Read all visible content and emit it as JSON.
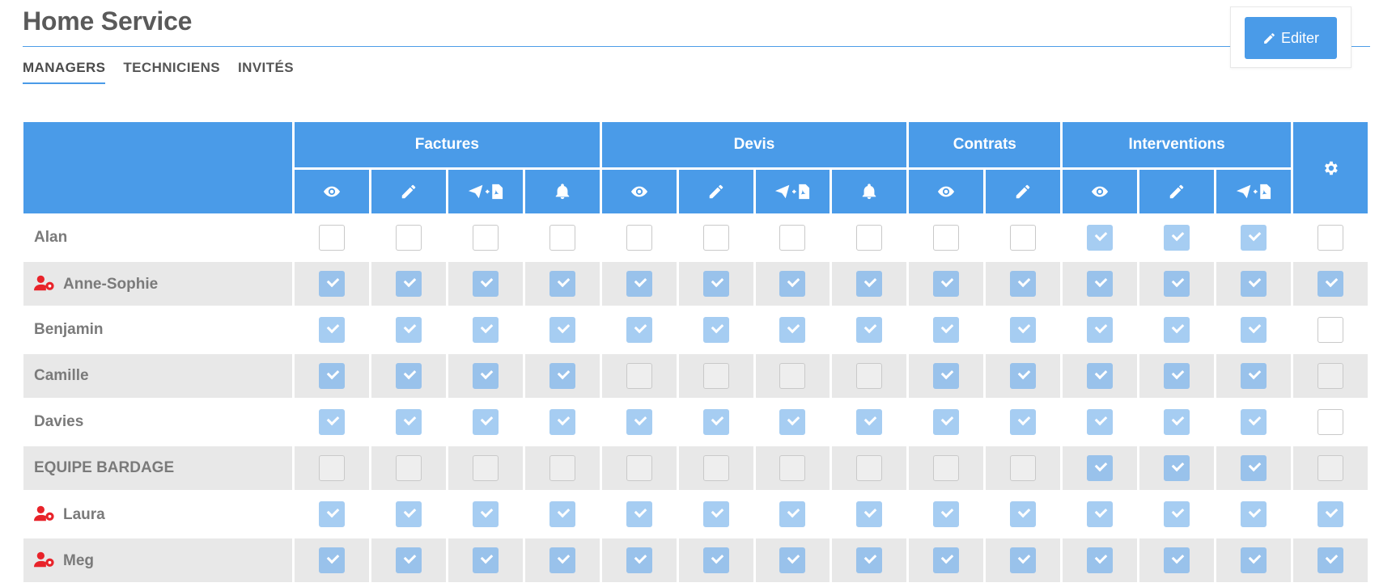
{
  "header": {
    "title": "Home Service",
    "edit_label": "Editer"
  },
  "tabs": [
    {
      "label": "MANAGERS",
      "active": true
    },
    {
      "label": "TECHNICIENS",
      "active": false
    },
    {
      "label": "INVITÉS",
      "active": false
    }
  ],
  "groups": [
    {
      "label": "Factures",
      "perms": [
        "view",
        "edit",
        "send-pdf",
        "notify"
      ]
    },
    {
      "label": "Devis",
      "perms": [
        "view",
        "edit",
        "send-pdf",
        "notify"
      ]
    },
    {
      "label": "Contrats",
      "perms": [
        "view",
        "edit"
      ]
    },
    {
      "label": "Interventions",
      "perms": [
        "view",
        "edit",
        "send-pdf"
      ]
    }
  ],
  "settings_column_icon": "gear-icon",
  "rows": [
    {
      "name": "Alan",
      "admin": false,
      "checks": [
        0,
        0,
        0,
        0,
        0,
        0,
        0,
        0,
        0,
        0,
        1,
        1,
        1,
        0
      ]
    },
    {
      "name": "Anne-Sophie",
      "admin": true,
      "checks": [
        1,
        1,
        1,
        1,
        1,
        1,
        1,
        1,
        1,
        1,
        1,
        1,
        1,
        1
      ]
    },
    {
      "name": "Benjamin",
      "admin": false,
      "checks": [
        1,
        1,
        1,
        1,
        1,
        1,
        1,
        1,
        1,
        1,
        1,
        1,
        1,
        0
      ]
    },
    {
      "name": "Camille",
      "admin": false,
      "checks": [
        1,
        1,
        1,
        1,
        0,
        0,
        0,
        0,
        1,
        1,
        1,
        1,
        1,
        0
      ]
    },
    {
      "name": "Davies",
      "admin": false,
      "checks": [
        1,
        1,
        1,
        1,
        1,
        1,
        1,
        1,
        1,
        1,
        1,
        1,
        1,
        0
      ]
    },
    {
      "name": "EQUIPE BARDAGE",
      "admin": false,
      "checks": [
        0,
        0,
        0,
        0,
        0,
        0,
        0,
        0,
        0,
        0,
        1,
        1,
        1,
        0
      ]
    },
    {
      "name": "Laura",
      "admin": true,
      "checks": [
        1,
        1,
        1,
        1,
        1,
        1,
        1,
        1,
        1,
        1,
        1,
        1,
        1,
        1
      ]
    },
    {
      "name": "Meg",
      "admin": true,
      "checks": [
        1,
        1,
        1,
        1,
        1,
        1,
        1,
        1,
        1,
        1,
        1,
        1,
        1,
        1
      ]
    }
  ],
  "colors": {
    "accent": "#4a9be8",
    "checked": "#a6cdf2",
    "admin_icon": "#e8232a"
  }
}
